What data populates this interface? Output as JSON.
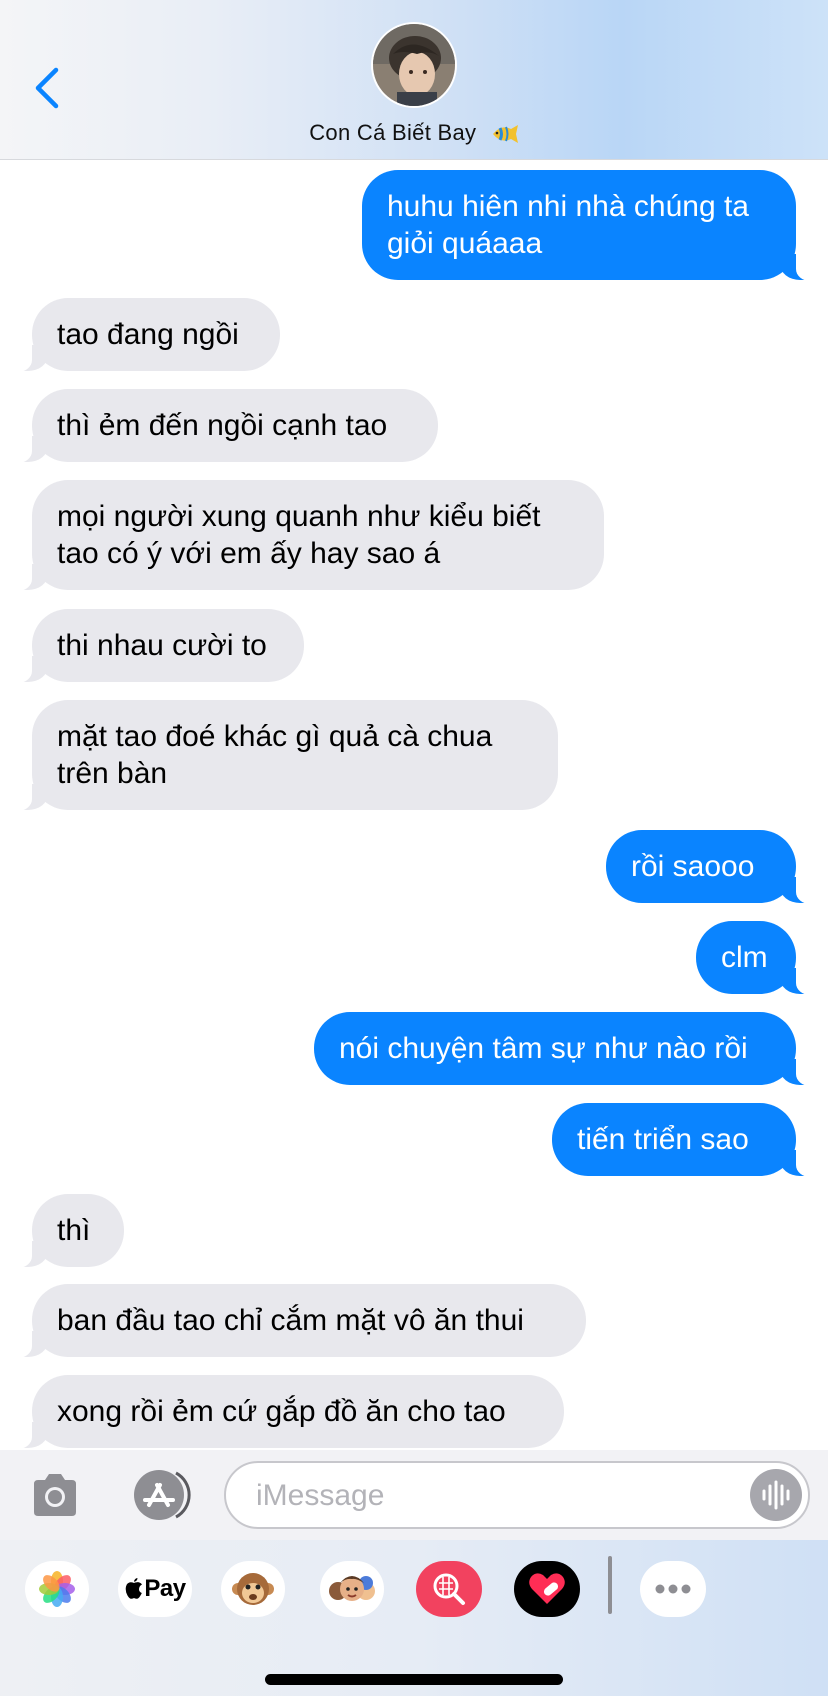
{
  "header": {
    "contact_name": "Con Cá Biết Bay",
    "contact_emoji_icon": "tropical-fish-icon",
    "avatar_icon": "contact-photo"
  },
  "messages": [
    {
      "from": "me",
      "text": "huhu hiên nhi nhà chúng ta\ngiỏi quáaaa"
    },
    {
      "from": "them",
      "text": "tao đang ngồi"
    },
    {
      "from": "them",
      "text": "thì ẻm đến ngồi cạnh tao"
    },
    {
      "from": "them",
      "text": "mọi người xung quanh như kiểu biết\ntao có ý với em ấy hay sao á"
    },
    {
      "from": "them",
      "text": "thi nhau cười to"
    },
    {
      "from": "them",
      "text": "mặt tao đoé khác gì quả cà chua\ntrên bàn"
    },
    {
      "from": "me",
      "text": "rồi saooo"
    },
    {
      "from": "me",
      "text": "clm"
    },
    {
      "from": "me",
      "text": "nói chuyện tâm sự như nào rồi"
    },
    {
      "from": "me",
      "text": "tiến triển sao"
    },
    {
      "from": "them",
      "text": "thì"
    },
    {
      "from": "them",
      "text": "ban đầu tao chỉ cắm mặt vô ăn thui"
    },
    {
      "from": "them",
      "text": "xong rồi ẻm cứ gắp đồ ăn cho tao"
    }
  ],
  "composer": {
    "placeholder": "iMessage",
    "camera_icon": "camera-icon",
    "appstore_icon": "app-store-icon",
    "audio_icon": "audio-waveform-icon"
  },
  "app_drawer": {
    "apps": [
      "photos-icon",
      "apple-pay-icon",
      "animoji-icon",
      "memoji-icon",
      "image-search-icon",
      "digital-touch-icon",
      "more-icon"
    ],
    "apple_pay_label": "Pay"
  },
  "colors": {
    "sent_bubble": "#0a84ff",
    "received_bubble": "#e8e8ed",
    "accent": "#0a84ff"
  }
}
